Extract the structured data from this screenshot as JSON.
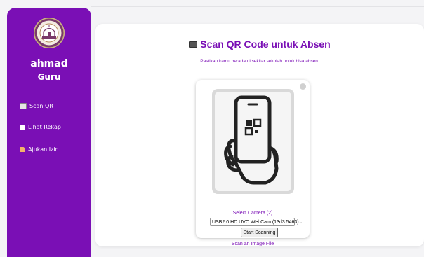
{
  "sidebar": {
    "user_name": "ahmad",
    "user_role": "Guru",
    "items": [
      {
        "label": "Scan QR",
        "icon": "camera-icon"
      },
      {
        "label": "Lihat Rekap",
        "icon": "document-icon"
      },
      {
        "label": "Ajukan Izin",
        "icon": "document-icon"
      }
    ]
  },
  "main": {
    "title": "Scan QR Code untuk Absen",
    "subtitle": "Pastikan kamu berada di sekitar sekolah untuk bisa absen."
  },
  "scanner": {
    "select_camera_label": "Select Camera (2)",
    "camera_selected": "USB2.0 HD UVC WebCam (13d3:5463)",
    "start_button_label": "Start Scanning",
    "scan_image_link": "Scan an Image File",
    "placeholder_icon": "phone-qr-scan-icon"
  },
  "colors": {
    "brand": "#7a0fb5",
    "background": "#f4f4f6",
    "card": "#ffffff"
  }
}
